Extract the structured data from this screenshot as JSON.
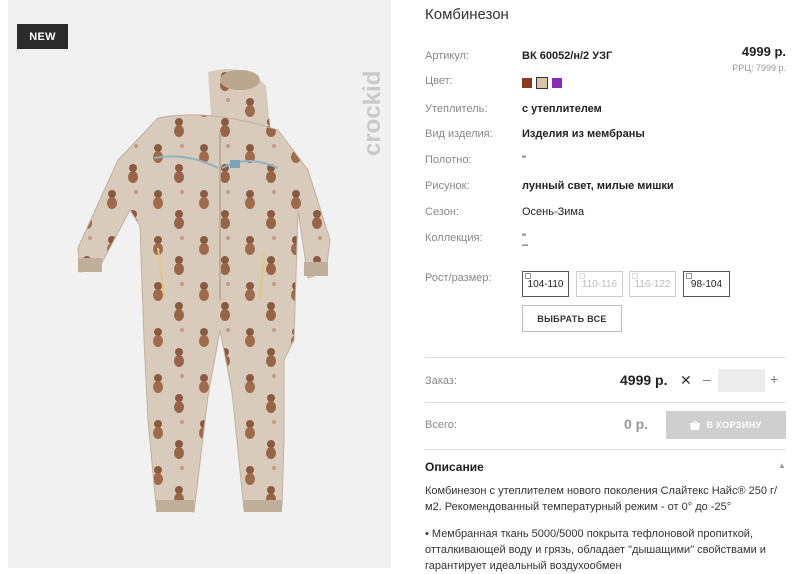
{
  "badge": {
    "new": "NEW"
  },
  "brand": {
    "logo_text": "crockid"
  },
  "product": {
    "title": "Комбинезон",
    "price": "4999 р.",
    "rrp": "РРЦ: 7999 р.",
    "attributes": [
      {
        "label": "Артикул:",
        "value": "ВК 60052/н/2 УЗГ"
      },
      {
        "label": "Цвет:",
        "value": ""
      },
      {
        "label": "Утеплитель:",
        "value": "с утеплителем"
      },
      {
        "label": "Вид изделия:",
        "value": "Изделия из мембраны"
      },
      {
        "label": "Полотно:",
        "value": "\""
      },
      {
        "label": "Рисунок:",
        "value": "лунный свет, милые мишки"
      },
      {
        "label": "Сезон:",
        "value": "Осень-Зима"
      },
      {
        "label": "Коллекция:",
        "value": "\"",
        "value2": "–"
      }
    ],
    "colors": [
      {
        "name": "brown",
        "hex": "#8b3a1f"
      },
      {
        "name": "beige",
        "hex": "#d6c4a8",
        "selected": true
      },
      {
        "name": "purple",
        "hex": "#8a2bb8"
      }
    ]
  },
  "sizes": {
    "label": "Рост/размер:",
    "options": [
      {
        "label": "104-110",
        "available": true
      },
      {
        "label": "110-116",
        "available": false
      },
      {
        "label": "116-122",
        "available": false
      },
      {
        "label": "98-104",
        "available": true
      }
    ],
    "select_all": "ВЫБРАТЬ ВСЕ"
  },
  "order": {
    "label": "Заказ:",
    "price": "4999 р.",
    "remove": "✕",
    "minus": "–",
    "plus": "+",
    "quantity": ""
  },
  "total": {
    "label": "Всего:",
    "value": "0 р.",
    "cart_button": "В КОРЗИНУ"
  },
  "description": {
    "heading": "Описание",
    "line1": "Комбинезон с утеплителем нового поколения Слайтекс Найс® 250 г/",
    "line2": "м2. Рекомендованный температурный режим - от 0° до -25°",
    "line3": "• Мембранная ткань 5000/5000 покрыта тефлоновой пропиткой,",
    "line4": "отталкивающей воду и грязь, обладает \"дышащими\" свойствами и",
    "line5": "гарантирует идеальный воздухообмен"
  },
  "colors_ui": {
    "accent_dark": "#2b2b2b",
    "panel_bg": "#f1f1f1",
    "cart_disabled": "#cfcfcf"
  }
}
